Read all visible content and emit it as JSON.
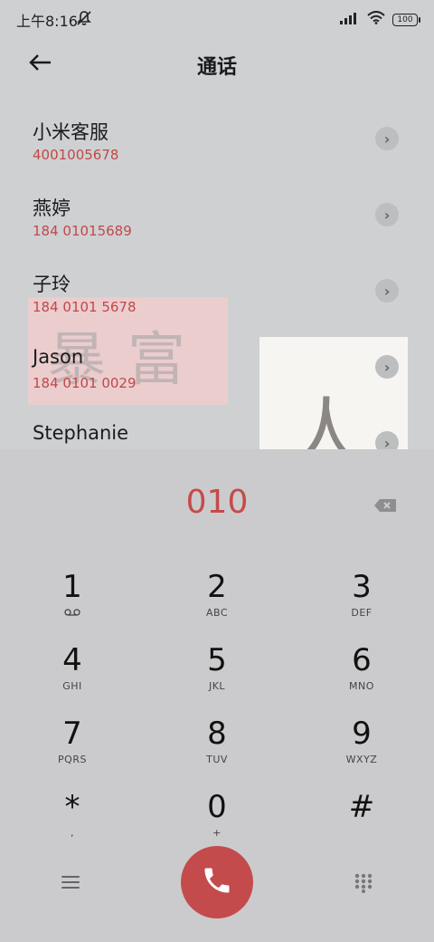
{
  "status": {
    "time": "上午8:16",
    "battery": "100"
  },
  "header": {
    "title": "通话"
  },
  "contacts": [
    {
      "name": "小米客服",
      "number": "4001005678"
    },
    {
      "name": "燕婷",
      "number": "184 01015689"
    },
    {
      "name": "子玲",
      "number": "184 0101 5678"
    },
    {
      "name": "Jason",
      "number": "184 0101 0029"
    },
    {
      "name": "Stephanie",
      "number": ""
    }
  ],
  "dialpad": {
    "input": "010",
    "keys": [
      {
        "digit": "1",
        "letters": "voicemail"
      },
      {
        "digit": "2",
        "letters": "ABC"
      },
      {
        "digit": "3",
        "letters": "DEF"
      },
      {
        "digit": "4",
        "letters": "GHI"
      },
      {
        "digit": "5",
        "letters": "JKL"
      },
      {
        "digit": "6",
        "letters": "MNO"
      },
      {
        "digit": "7",
        "letters": "PQRS"
      },
      {
        "digit": "8",
        "letters": "TUV"
      },
      {
        "digit": "9",
        "letters": "WXYZ"
      },
      {
        "digit": "*",
        "letters": ","
      },
      {
        "digit": "0",
        "letters": "+"
      },
      {
        "digit": "#",
        "letters": ""
      }
    ]
  },
  "icons": {
    "back": "arrow-left-icon",
    "delete": "backspace-icon",
    "menu": "menu-icon",
    "call": "phone-icon",
    "keypad": "keypad-icon"
  },
  "colors": {
    "accent": "#c44b4b",
    "background": "#cbcbcd"
  }
}
